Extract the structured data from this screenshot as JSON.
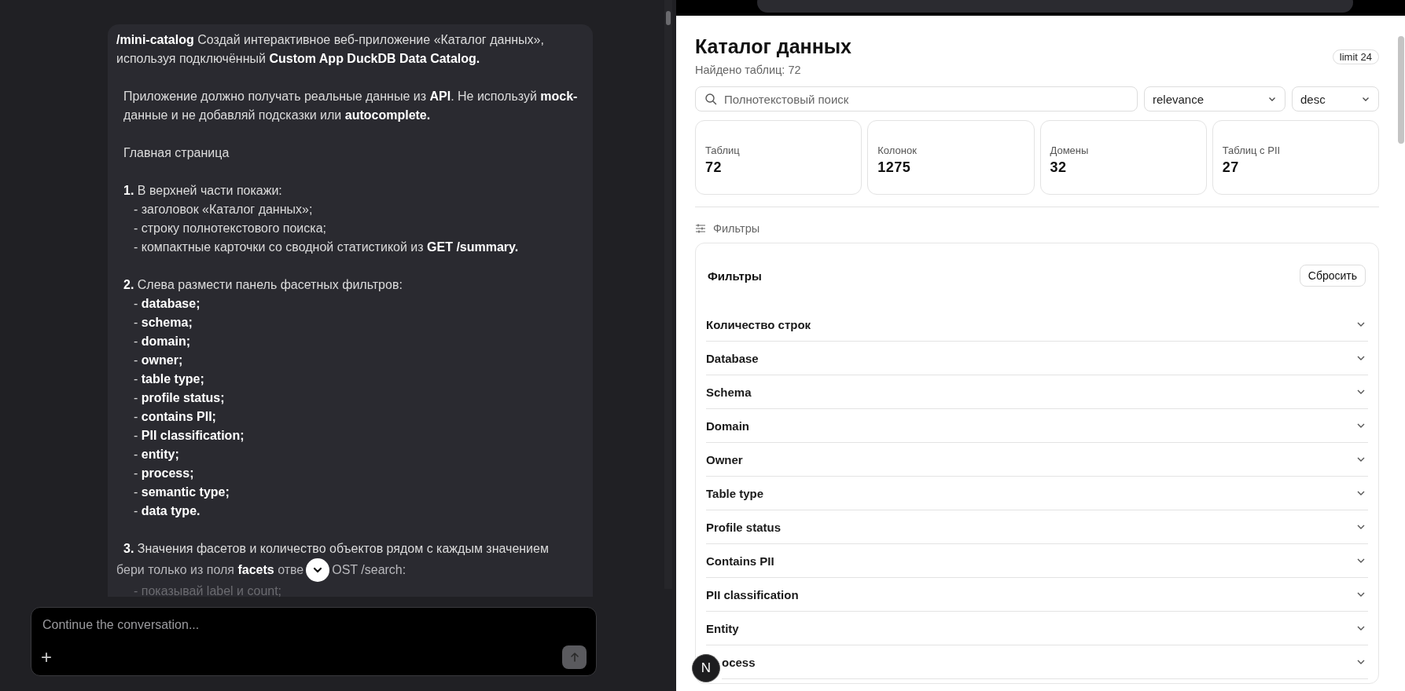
{
  "chat": {
    "blocks": [
      {
        "lines": [
          {
            "kind": "para",
            "text": "**/mini-catalog** Создай интерактивное веб-приложение «Каталог данных», используя подключённый **Custom App DuckDB Data Catalog.**"
          }
        ]
      },
      {
        "lines": [
          {
            "kind": "lead",
            "text": "Приложение должно получать реальные данные из **API**. Не используй **mock-**данные и не добавляй подсказки или **autocomplete.**"
          }
        ]
      },
      {
        "lines": [
          {
            "kind": "lead",
            "text": "Главная страница"
          }
        ]
      },
      {
        "lines": [
          {
            "kind": "lead",
            "text": "**1.** В верхней части покажи:"
          },
          {
            "kind": "bullet",
            "text": "- заголовок «Каталог данных»;"
          },
          {
            "kind": "bullet",
            "text": "- строку полнотекстового поиска;"
          },
          {
            "kind": "bullet",
            "text": "- компактные карточки со сводной статистикой из **GET /summary.**"
          }
        ]
      },
      {
        "lines": [
          {
            "kind": "lead",
            "text": "**2.** Слева размести панель фасетных фильтров:"
          },
          {
            "kind": "bullet",
            "text": "- **database;**"
          },
          {
            "kind": "bullet",
            "text": "- **schema;**"
          },
          {
            "kind": "bullet",
            "text": "- **domain;**"
          },
          {
            "kind": "bullet",
            "text": "- **owner;**"
          },
          {
            "kind": "bullet",
            "text": "- **table type;**"
          },
          {
            "kind": "bullet",
            "text": "- **profile status;**"
          },
          {
            "kind": "bullet",
            "text": "- **contains PII;**"
          },
          {
            "kind": "bullet",
            "text": "- **PII classification;**"
          },
          {
            "kind": "bullet",
            "text": "- **entity;**"
          },
          {
            "kind": "bullet",
            "text": "- **process;**"
          },
          {
            "kind": "bullet",
            "text": "- **semantic type;**"
          },
          {
            "kind": "bullet",
            "text": "- **data type.**"
          }
        ]
      },
      {
        "lines": [
          {
            "kind": "lead",
            "text": "**3.** Значения фасетов и количество объектов рядом с каждым значением"
          },
          {
            "kind": "split",
            "parts": [
              "бери только из поля **facets** отве",
              "OST /search:"
            ]
          },
          {
            "kind": "faded",
            "text": "- показывай label и count;"
          }
        ]
      }
    ]
  },
  "composer": {
    "placeholder": "Continue the conversation...",
    "plus": "+"
  },
  "app": {
    "title": "Каталог данных",
    "subtitle": "Найдено таблиц: 72",
    "limit": "limit 24",
    "search": {
      "placeholder": "Полнотекстовый поиск"
    },
    "sort": {
      "value": "relevance"
    },
    "order": {
      "value": "desc"
    },
    "stats": [
      {
        "label": "Таблиц",
        "value": "72"
      },
      {
        "label": "Колонок",
        "value": "1275"
      },
      {
        "label": "Домены",
        "value": "32"
      },
      {
        "label": "Таблиц с PII",
        "value": "27"
      }
    ],
    "filters_toggle": "Фильтры",
    "filters": {
      "title": "Фильтры",
      "reset": "Сбросить",
      "rows": [
        {
          "label": "Количество строк",
          "expanded": false
        },
        {
          "label": "Database",
          "expanded": false
        },
        {
          "label": "Schema",
          "expanded": false
        },
        {
          "label": "Domain",
          "expanded": false
        },
        {
          "label": "Owner",
          "expanded": false
        },
        {
          "label": "Table type",
          "expanded": false
        },
        {
          "label": "Profile status",
          "expanded": false
        },
        {
          "label": "Contains PII",
          "expanded": false
        },
        {
          "label": "PII classification",
          "expanded": false
        },
        {
          "label": "Entity",
          "expanded": false
        },
        {
          "label": "ocess",
          "expanded": false,
          "badge": "N"
        }
      ]
    }
  }
}
